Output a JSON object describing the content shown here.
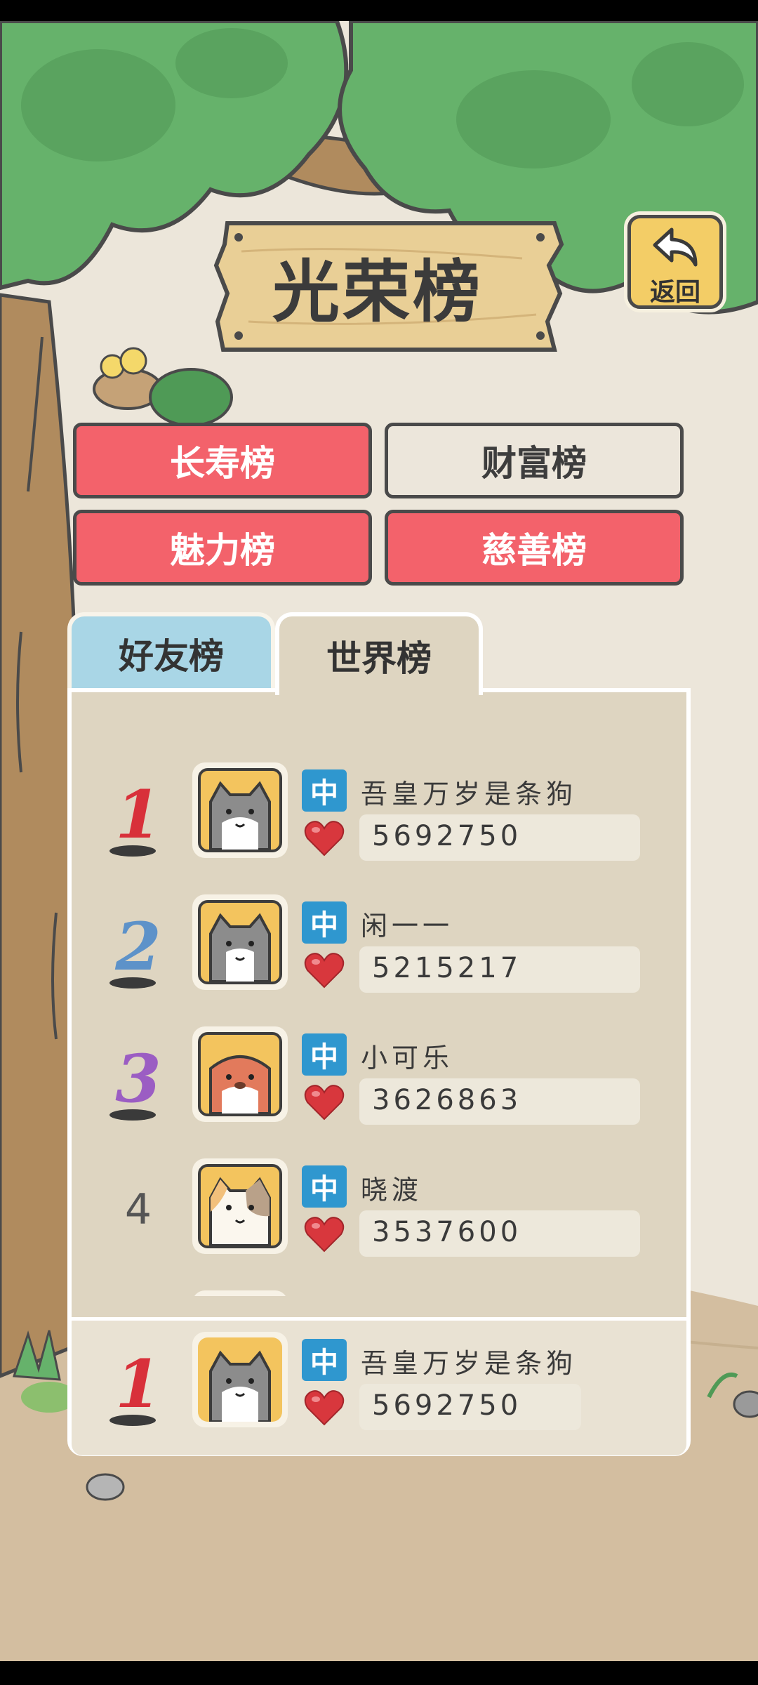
{
  "header": {
    "title": "光荣榜",
    "back_label": "返回"
  },
  "categories": [
    {
      "label": "长寿榜",
      "style": "red"
    },
    {
      "label": "财富榜",
      "style": "light"
    },
    {
      "label": "魅力榜",
      "style": "red"
    },
    {
      "label": "慈善榜",
      "style": "red"
    }
  ],
  "tabs": {
    "friends": "好友榜",
    "world": "世界榜",
    "active": "world"
  },
  "rankings": [
    {
      "rank": "1",
      "badge": "中",
      "name": "吾皇万岁是条狗",
      "score": "5692750",
      "rank_color": "#d8303a"
    },
    {
      "rank": "2",
      "badge": "中",
      "name": "闲一一",
      "score": "5215217",
      "rank_color": "#5d92c9"
    },
    {
      "rank": "3",
      "badge": "中",
      "name": "小可乐",
      "score": "3626863",
      "rank_color": "#9b5dc3"
    },
    {
      "rank": "4",
      "badge": "中",
      "name": "晓渡",
      "score": "3537600",
      "rank_color": "#555555"
    }
  ],
  "my_entry": {
    "rank": "1",
    "badge": "中",
    "name": "吾皇万岁是条狗",
    "score": "5692750",
    "rank_color": "#d8303a"
  },
  "colors": {
    "sky": "#ece6da",
    "tree": "#66b26b",
    "trunk": "#b08b5e",
    "ground": "#d3bea0",
    "heart": "#d8373d",
    "badge": "#2f97cf"
  },
  "icons": {
    "back": "back-arrow-icon",
    "heart": "heart-icon"
  }
}
